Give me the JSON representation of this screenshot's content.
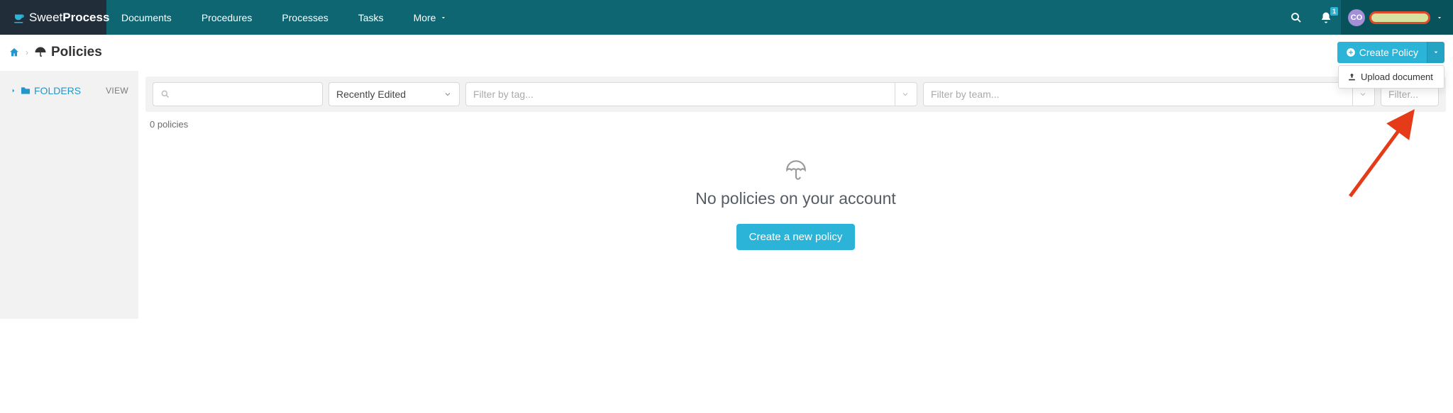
{
  "brand": {
    "sweet": "Sweet",
    "process": "Process"
  },
  "nav": {
    "documents": "Documents",
    "procedures": "Procedures",
    "processes": "Processes",
    "tasks": "Tasks",
    "more": "More"
  },
  "notifications": {
    "count": "1"
  },
  "user": {
    "initials": "CO"
  },
  "breadcrumb": {
    "title": "Policies"
  },
  "create": {
    "button": "Create Policy",
    "upload": "Upload document"
  },
  "sidebar": {
    "folders": "FOLDERS",
    "view": "VIEW"
  },
  "filters": {
    "sort": "Recently Edited",
    "tag_placeholder": "Filter by tag...",
    "team_placeholder": "Filter by team...",
    "last_placeholder": "Filter..."
  },
  "list": {
    "count": "0 policies"
  },
  "empty": {
    "message": "No policies on your account",
    "cta": "Create a new policy"
  }
}
